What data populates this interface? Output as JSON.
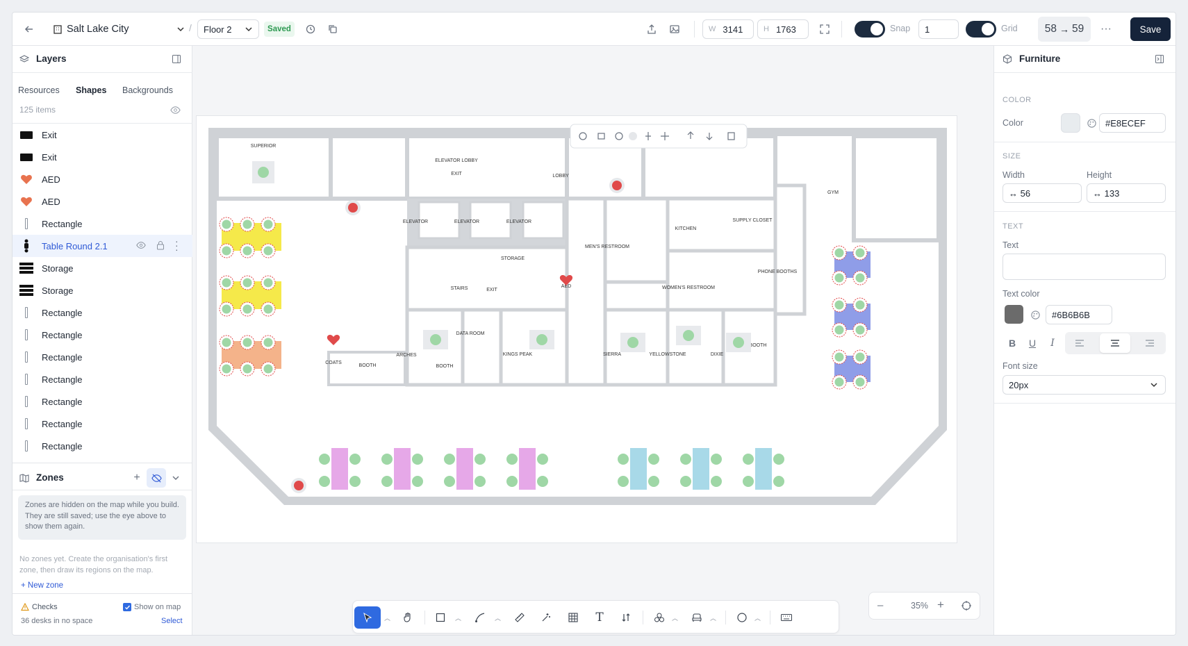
{
  "topbar": {
    "location": "Salt Lake City",
    "floor": "Floor 2",
    "saved": "Saved",
    "w_label": "W",
    "w_value": "3141",
    "h_label": "H",
    "h_value": "1763",
    "snap_label": "Snap",
    "snap_value": "1",
    "grid_label": "Grid",
    "version_from": "58",
    "version_arrow": "→",
    "version_to": "59",
    "save_label": "Save"
  },
  "layers": {
    "title": "Layers",
    "tabs": [
      "Resources",
      "Shapes",
      "Backgrounds"
    ],
    "count": "125 items",
    "items": [
      {
        "label": "Exit",
        "thumb": "exit-sign"
      },
      {
        "label": "Exit",
        "thumb": "exit-sign"
      },
      {
        "label": "AED",
        "thumb": "aed-heart"
      },
      {
        "label": "AED",
        "thumb": "aed-heart"
      },
      {
        "label": "Rectangle",
        "thumb": "rectangle"
      },
      {
        "label": "Table Round 2.1",
        "thumb": "table-round"
      },
      {
        "label": "Storage",
        "thumb": "storage"
      },
      {
        "label": "Storage",
        "thumb": "storage"
      },
      {
        "label": "Rectangle",
        "thumb": "rectangle"
      },
      {
        "label": "Rectangle",
        "thumb": "rectangle"
      },
      {
        "label": "Rectangle",
        "thumb": "rectangle"
      },
      {
        "label": "Rectangle",
        "thumb": "rectangle"
      },
      {
        "label": "Rectangle",
        "thumb": "rectangle"
      },
      {
        "label": "Rectangle",
        "thumb": "rectangle"
      },
      {
        "label": "Rectangle",
        "thumb": "rectangle"
      }
    ]
  },
  "zones": {
    "title": "Zones",
    "notice": "Zones are hidden on the map while you build. They are still saved; use the eye above to show them again.",
    "empty": "No zones yet. Create the organisation's first zone, then draw its regions on the map.",
    "new_zone": "+ New zone"
  },
  "checks": {
    "title": "Checks",
    "show_on_map": "Show on map",
    "status": "36 desks in no space",
    "select": "Select"
  },
  "furniture": {
    "title": "Furniture",
    "color_section": "COLOR",
    "color_label": "Color",
    "color_value": "#E8ECEF",
    "size_section": "SIZE",
    "width_label": "Width",
    "width_value": "↔ 56",
    "height_label": "Height",
    "height_value": "↔ 133",
    "text_section": "TEXT",
    "text_label": "Text",
    "text_color_label": "Text color",
    "text_color_value": "#6B6B6B",
    "font_size_label": "Font size",
    "font_size_value": "20px",
    "colors": {
      "swatch": "#E8ECEF",
      "text": "#6B6B6B"
    }
  },
  "zoom": {
    "minus": "–",
    "value": "35%",
    "plus": "+"
  },
  "floorplan": {
    "rooms": [
      "SUPERIOR",
      "ELEVATOR LOBBY",
      "EXIT",
      "LOBBY",
      "GYM",
      "ELEVATOR",
      "ELEVATOR",
      "ELEVATOR",
      "SUPPLY CLOSET",
      "KITCHEN",
      "MEN'S RESTROOM",
      "STAIRS",
      "STORAGE",
      "EXIT",
      "AED",
      "WOMEN'S RESTROOM",
      "PHONE BOOTHS",
      "DATA ROOM",
      "AED",
      "COATS",
      "BOOTH",
      "ARCHES",
      "BOOTH",
      "KINGS PEAK",
      "SIERRA",
      "YELLOWSTONE",
      "DIXIE",
      "BOOTH"
    ]
  },
  "accent": "#1c2b3f"
}
